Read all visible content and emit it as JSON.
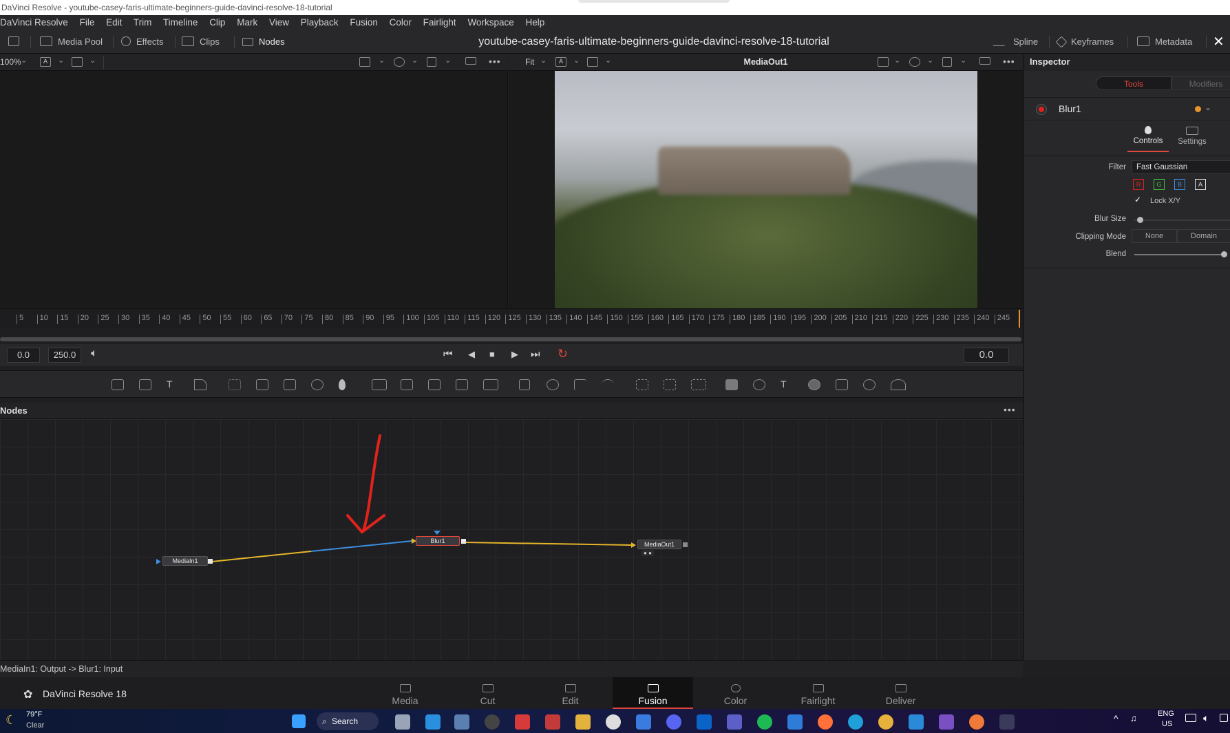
{
  "window": {
    "title": "DaVinci Resolve - youtube-casey-faris-ultimate-beginners-guide-davinci-resolve-18-tutorial"
  },
  "menu": [
    "DaVinci Resolve",
    "File",
    "Edit",
    "Trim",
    "Timeline",
    "Clip",
    "Mark",
    "View",
    "Playback",
    "Fusion",
    "Color",
    "Fairlight",
    "Workspace",
    "Help"
  ],
  "toolbar": {
    "media_pool": "Media Pool",
    "effects": "Effects",
    "clips": "Clips",
    "nodes": "Nodes",
    "project_title": "youtube-casey-faris-ultimate-beginners-guide-davinci-resolve-18-tutorial",
    "spline": "Spline",
    "keyframes": "Keyframes",
    "metadata": "Metadata"
  },
  "viewer_left": {
    "zoom": "100%",
    "channel": "A"
  },
  "viewer_right": {
    "zoom": "Fit",
    "channel": "A",
    "title": "MediaOut1"
  },
  "inspector": {
    "title": "Inspector",
    "tabs": [
      "Tools",
      "Modifiers"
    ],
    "node_name": "Blur1",
    "subtabs": [
      "Controls",
      "Settings"
    ],
    "filter_label": "Filter",
    "filter_value": "Fast Gaussian",
    "channels": [
      "R",
      "G",
      "B",
      "A"
    ],
    "lock_label": "Lock X/Y",
    "lock_checked": true,
    "blur_size_label": "Blur Size",
    "blur_size_value": 0,
    "clipping_label": "Clipping Mode",
    "clipping_options": [
      "None",
      "Domain"
    ],
    "blend_label": "Blend",
    "blend_value": 1
  },
  "ruler": {
    "ticks": [
      "5",
      "10",
      "15",
      "20",
      "25",
      "30",
      "35",
      "40",
      "45",
      "50",
      "55",
      "60",
      "65",
      "70",
      "75",
      "80",
      "85",
      "90",
      "95",
      "100",
      "105",
      "110",
      "115",
      "120",
      "125",
      "130",
      "135",
      "140",
      "145",
      "150",
      "155",
      "160",
      "165",
      "170",
      "175",
      "180",
      "185",
      "190",
      "195",
      "200",
      "205",
      "210",
      "215",
      "220",
      "225",
      "230",
      "235",
      "240",
      "245"
    ]
  },
  "transport": {
    "start": "0.0",
    "end": "250.0",
    "current": "0.0"
  },
  "nodes_panel": {
    "title": "Nodes",
    "nodes": [
      "MediaIn1",
      "Blur1",
      "MediaOut1"
    ]
  },
  "status": "MediaIn1: Output -> Blur1: Input",
  "app_name": "DaVinci Resolve 18",
  "pages": [
    "Media",
    "Cut",
    "Edit",
    "Fusion",
    "Color",
    "Fairlight",
    "Deliver"
  ],
  "active_page": "Fusion",
  "taskbar": {
    "weather_temp": "79°F",
    "weather_desc": "Clear",
    "search": "Search",
    "lang": "ENG",
    "region": "US"
  },
  "colors": {
    "accent": "#e0463b",
    "link_yellow": "#e5b52b",
    "link_blue": "#3d8fe0",
    "annotation": "#e0231c"
  }
}
